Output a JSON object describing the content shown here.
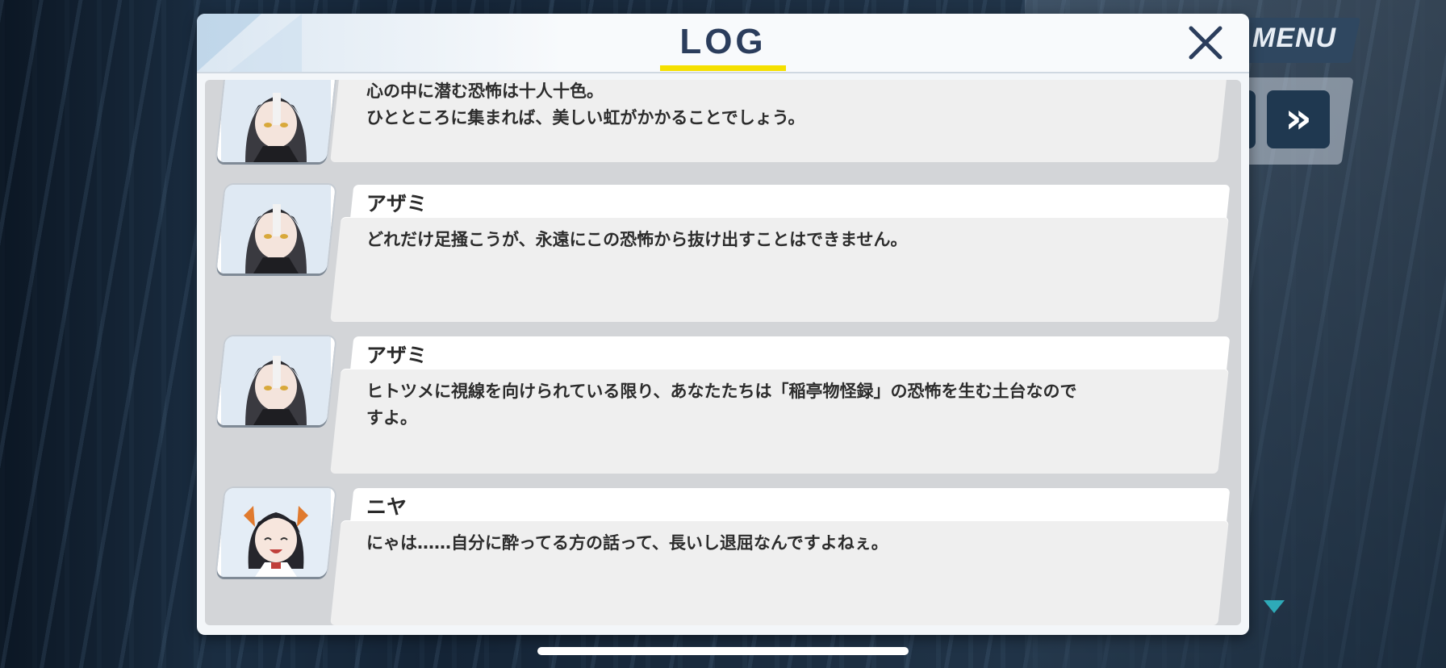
{
  "background_ui": {
    "menu_label": "MENU",
    "skip_label": "»"
  },
  "dialog": {
    "title": "LOG",
    "accent_color": "#f5e000",
    "title_color": "#2b3d5c"
  },
  "entries": [
    {
      "speaker": "",
      "portrait": "azami-portrait",
      "text": "心の中に潜む恐怖は十人十色。\nひとところに集まれば、美しい虹がかかることでしょう。"
    },
    {
      "speaker": "アザミ",
      "portrait": "azami-portrait",
      "text": "どれだけ足掻こうが、永遠にこの恐怖から抜け出すことはできません。"
    },
    {
      "speaker": "アザミ",
      "portrait": "azami-portrait",
      "text": "ヒトツメに視線を向けられている限り、あなたたちは「稲亭物怪録」の恐怖を生む土台なので\nすよ。"
    },
    {
      "speaker": "ニヤ",
      "portrait": "niya-portrait",
      "text": "にゃは……自分に酔ってる方の話って、長いし退屈なんですよねぇ。"
    }
  ]
}
